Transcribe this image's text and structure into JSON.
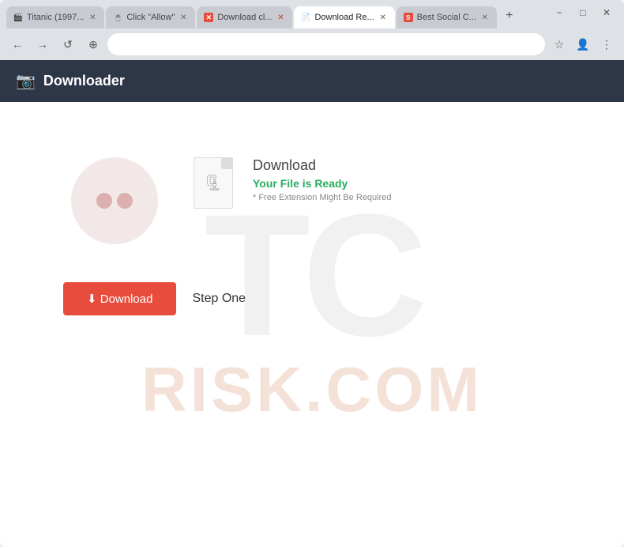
{
  "browser": {
    "tabs": [
      {
        "id": "tab-titanic",
        "label": "Titanic (1997...",
        "favicon": "film",
        "active": false,
        "closeable": true
      },
      {
        "id": "tab-click",
        "label": "Click \"Allow\"",
        "favicon": "cursor",
        "active": false,
        "closeable": true
      },
      {
        "id": "tab-download-x",
        "label": "Download cl...",
        "favicon": "x",
        "active": false,
        "closeable": true
      },
      {
        "id": "tab-download-active",
        "label": "Download Re...",
        "favicon": "page",
        "active": true,
        "closeable": true
      },
      {
        "id": "tab-social",
        "label": "Best Social C...",
        "favicon": "social",
        "active": false,
        "closeable": true
      }
    ],
    "new_tab_label": "+",
    "window_controls": {
      "minimize": "−",
      "maximize": "□",
      "close": "✕"
    },
    "nav": {
      "back": "←",
      "forward": "→",
      "reload": "↺",
      "site_info": "⊕",
      "address": "",
      "bookmark": "☆",
      "profile": "👤",
      "menu": "⋮"
    }
  },
  "header": {
    "icon": "📷",
    "title": "Downloader"
  },
  "main": {
    "watermark_large": "TC",
    "watermark_small": "RISK.COM",
    "download_title": "Download",
    "download_subtitle": "Your File is Ready",
    "download_note": "* Free Extension Might Be Required",
    "download_button_label": "⬇ Download",
    "step_label": "Step One"
  }
}
